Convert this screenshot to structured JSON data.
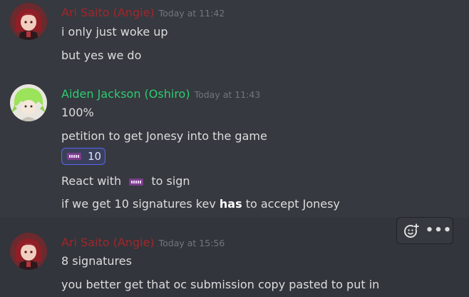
{
  "colors": {
    "background": "#36393f",
    "hover_background": "#32353b",
    "angie_name": "#a0272d",
    "aiden_name": "#2ecc71",
    "reaction_border": "#5865f2"
  },
  "messages": [
    {
      "author": "Ari Saito (Angie)",
      "timestamp": "Today at 11:42",
      "avatar_icon": "red-haired-character-avatar",
      "lines": [
        "i only just woke up",
        "but yes we do"
      ]
    },
    {
      "author": "Aiden Jackson (Oshiro)",
      "timestamp": "Today at 11:43",
      "avatar_icon": "green-haired-character-avatar",
      "lines": [
        "100%",
        "petition to get Jonesy into the game"
      ],
      "reaction": {
        "emoji": "ticket-emoji",
        "count": "10"
      },
      "after_reaction": {
        "sign_pre": "React with",
        "sign_post": "to sign",
        "cond_pre": "if we get 10 signatures kev",
        "cond_bold": "has",
        "cond_post": "to accept Jonesy"
      }
    },
    {
      "author": "Ari Saito (Angie)",
      "timestamp": "Today at 15:56",
      "avatar_icon": "red-haired-character-avatar",
      "lines": [
        "8 signatures",
        "you better get that oc submission copy pasted to put in"
      ]
    }
  ],
  "toolbar": {
    "add_reaction_icon": "add-reaction-icon",
    "more_icon": "more-options-icon",
    "more_glyph": "•••"
  }
}
